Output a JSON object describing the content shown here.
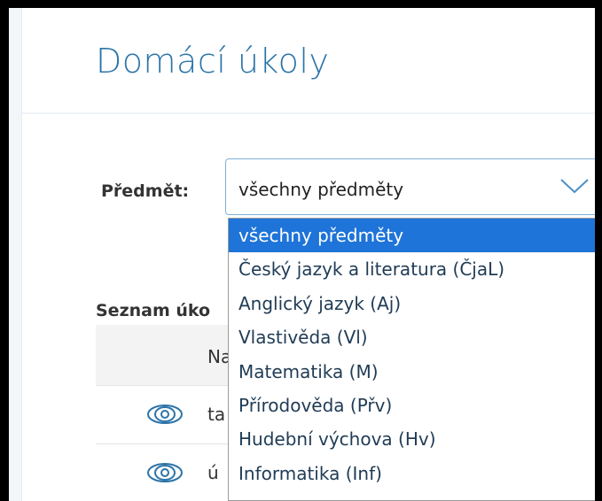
{
  "page": {
    "title": "Domácí úkoly"
  },
  "filter": {
    "label": "Předmět:",
    "selected_value": "všechny předměty",
    "options": [
      "všechny předměty",
      "Český jazyk a literatura (ČjaL)",
      "Anglický jazyk (Aj)",
      "Vlastivěda (Vl)",
      "Matematika (M)",
      "Přírodověda (Přv)",
      "Hudební výchova (Hv)",
      "Informatika (Inf)"
    ],
    "selected_index": 0
  },
  "list": {
    "title": "Seznam úko",
    "header": "Na",
    "rows": [
      {
        "icon": "eye-icon",
        "text": "ta"
      },
      {
        "icon": "eye-icon",
        "text": "ú"
      }
    ]
  },
  "colors": {
    "title": "#2c74a8",
    "select_border": "#7fb0d8",
    "selected_option": "#1e74d8",
    "frame": "#000000"
  }
}
